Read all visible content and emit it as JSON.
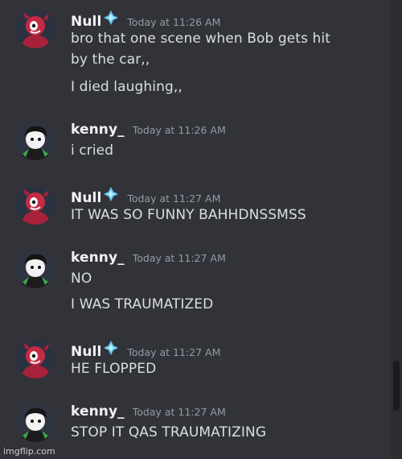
{
  "messages": [
    {
      "user": "Null",
      "avatar": "null-avatar",
      "timestamp": "Today at 11:26 AM",
      "lines": [
        "bro that one scene when Bob gets hit",
        "by the car,,",
        "I died laughing,,"
      ]
    },
    {
      "user": "kenny_",
      "avatar": "kenny-avatar",
      "timestamp": "Today at 11:26 AM",
      "lines": [
        "i cried"
      ]
    },
    {
      "user": "Null",
      "avatar": "null-avatar",
      "timestamp": "Today at 11:27 AM",
      "lines": [
        "IT WAS SO FUNNY BAHHDNSSMSS"
      ]
    },
    {
      "user": "kenny_",
      "avatar": "kenny-avatar",
      "timestamp": "Today at 11:27 AM",
      "lines": [
        "NO",
        "I WAS TRAUMATIZED"
      ]
    },
    {
      "user": "Null",
      "avatar": "null-avatar",
      "timestamp": "Today at 11:27 AM",
      "lines": [
        "HE FLOPPED"
      ]
    },
    {
      "user": "kenny_",
      "avatar": "kenny-avatar",
      "timestamp": "Today at 11:27 AM",
      "lines": [
        "STOP IT QAS TRAUMATIZING"
      ]
    }
  ],
  "badge_icon": "diamond-badge-icon",
  "watermark": "imgflip.com",
  "colors": {
    "background": "#313338",
    "username": "#f2f3f5",
    "message_text": "#dbdee1",
    "timestamp": "#949ba4",
    "null_avatar": "#a8213a",
    "kenny_avatar": "#2b2b2b",
    "badge": "#5fc8f0"
  }
}
